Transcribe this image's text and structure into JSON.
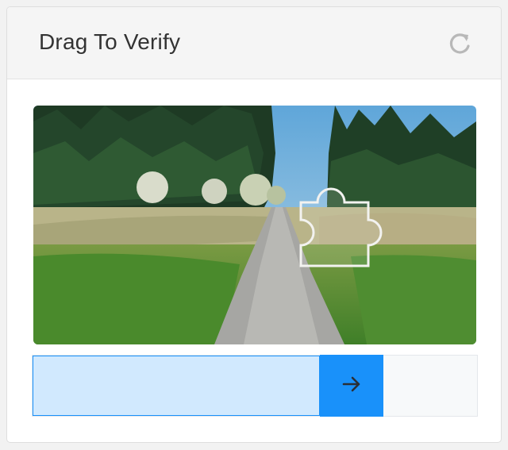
{
  "header": {
    "title": "Drag To Verify",
    "refresh_icon": "refresh-icon"
  },
  "captcha": {
    "image_icon": "landscape-photo",
    "puzzle_piece": "puzzle-piece-outline",
    "slider_progress": 0.65,
    "handle_icon": "arrow-right-icon"
  },
  "colors": {
    "accent": "#1991fa",
    "track_fill": "#d1e9fe",
    "header_bg": "#f5f5f5",
    "title_text": "#333333"
  }
}
